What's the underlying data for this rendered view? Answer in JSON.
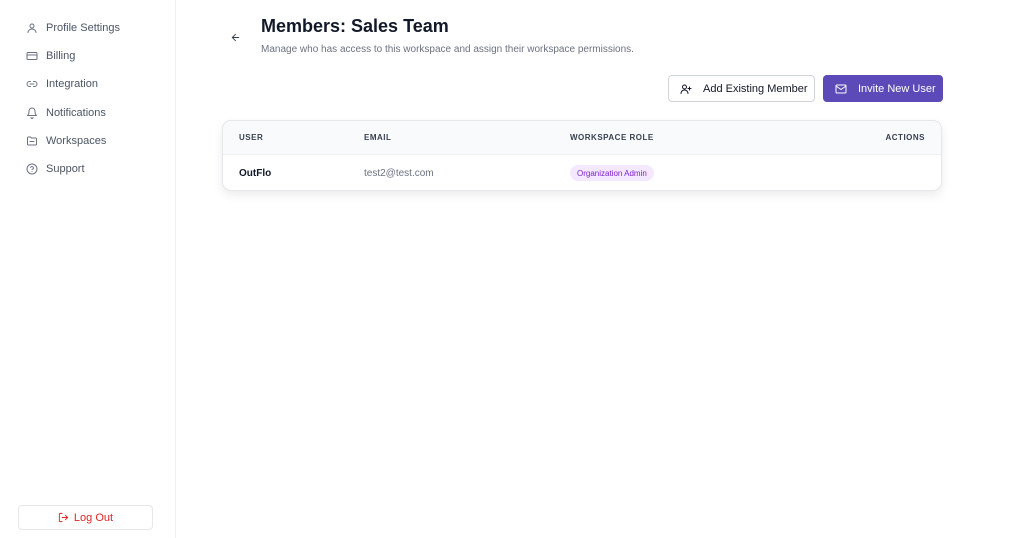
{
  "sidebar": {
    "items": [
      {
        "label": "Profile Settings",
        "icon": "user-icon"
      },
      {
        "label": "Billing",
        "icon": "credit-card-icon"
      },
      {
        "label": "Integration",
        "icon": "link-icon"
      },
      {
        "label": "Notifications",
        "icon": "bell-icon"
      },
      {
        "label": "Workspaces",
        "icon": "folder-icon"
      },
      {
        "label": "Support",
        "icon": "help-circle-icon"
      }
    ],
    "logout_label": "Log Out"
  },
  "header": {
    "title": "Members: Sales Team",
    "subtitle": "Manage who has access to this workspace and assign their workspace permissions."
  },
  "actions": {
    "add_existing_label": "Add Existing Member",
    "invite_label": "Invite New User"
  },
  "table": {
    "columns": [
      "USER",
      "EMAIL",
      "WORKSPACE ROLE",
      "ACTIONS"
    ],
    "rows": [
      {
        "user": "OutFlo",
        "email": "test2@test.com",
        "role": "Organization Admin"
      }
    ]
  },
  "colors": {
    "accent": "#5b4ab8",
    "danger": "#dc2626",
    "badge_bg": "#f3e8ff",
    "badge_text": "#7e22ce"
  }
}
